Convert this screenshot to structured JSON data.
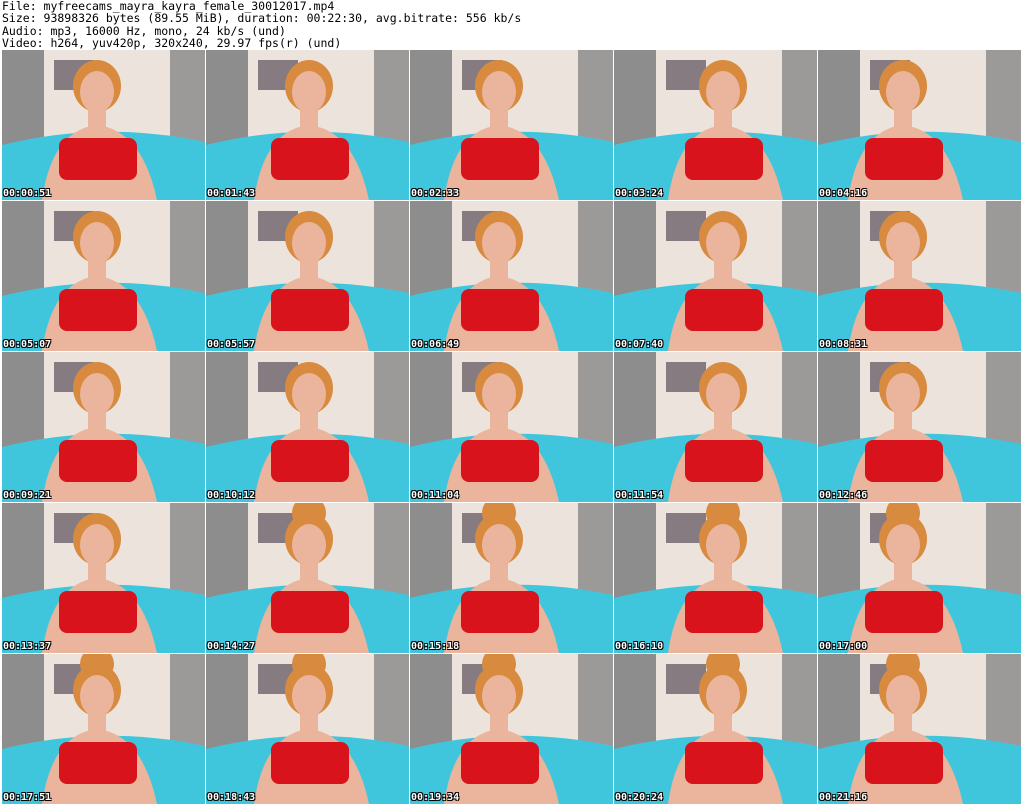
{
  "header": {
    "file_line": "File: myfreecams_mayra_kayra_female_30012017.mp4",
    "size_line": "Size: 93898326 bytes (89.55 MiB), duration: 00:22:30, avg.bitrate: 556 kb/s",
    "audio_line": "Audio: mp3, 16000 Hz, mono, 24 kb/s (und)",
    "video_line": "Video: h264, yuv420p, 320x240, 29.97 fps(r) (und)"
  },
  "thumbnails": [
    {
      "timestamp": "00:00:51",
      "bun": false
    },
    {
      "timestamp": "00:01:43",
      "bun": false
    },
    {
      "timestamp": "00:02:33",
      "bun": false
    },
    {
      "timestamp": "00:03:24",
      "bun": false
    },
    {
      "timestamp": "00:04:16",
      "bun": false
    },
    {
      "timestamp": "00:05:07",
      "bun": false
    },
    {
      "timestamp": "00:05:57",
      "bun": false
    },
    {
      "timestamp": "00:06:49",
      "bun": false
    },
    {
      "timestamp": "00:07:40",
      "bun": false
    },
    {
      "timestamp": "00:08:31",
      "bun": false
    },
    {
      "timestamp": "00:09:21",
      "bun": false
    },
    {
      "timestamp": "00:10:12",
      "bun": false
    },
    {
      "timestamp": "00:11:04",
      "bun": false
    },
    {
      "timestamp": "00:11:54",
      "bun": false
    },
    {
      "timestamp": "00:12:46",
      "bun": false
    },
    {
      "timestamp": "00:13:37",
      "bun": false
    },
    {
      "timestamp": "00:14:27",
      "bun": true
    },
    {
      "timestamp": "00:15:18",
      "bun": true
    },
    {
      "timestamp": "00:16:10",
      "bun": true
    },
    {
      "timestamp": "00:17:00",
      "bun": true
    },
    {
      "timestamp": "00:17:51",
      "bun": true
    },
    {
      "timestamp": "00:18:43",
      "bun": true
    },
    {
      "timestamp": "00:19:34",
      "bun": true
    },
    {
      "timestamp": "00:20:24",
      "bun": true
    },
    {
      "timestamp": "00:21:16",
      "bun": true
    }
  ],
  "colors": {
    "bed": "#3fc6dc",
    "wall": "#ece4dc",
    "curtain": "#8d8d8d",
    "top": "#d8131b",
    "skin": "#eab49d",
    "hair": "#d88a3e"
  }
}
